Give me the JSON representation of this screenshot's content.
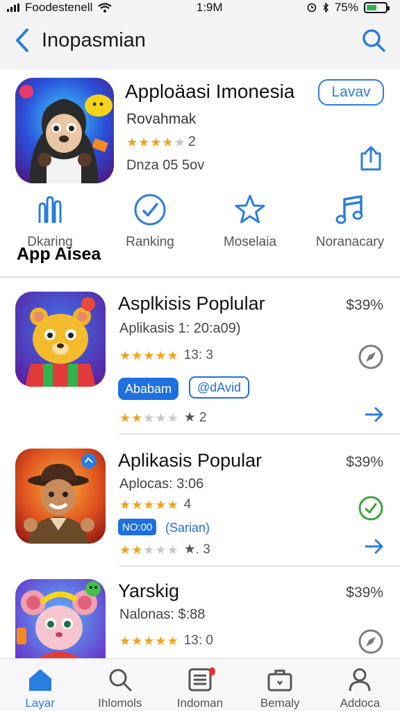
{
  "status_bar": {
    "carrier": "Foodestenell",
    "time": "1:9M",
    "battery_text": "75%",
    "battery_level": 0.55
  },
  "nav": {
    "back_icon": "chevron-left-icon",
    "title": "Inopasmian",
    "search_icon": "search-icon"
  },
  "featured": {
    "title": "Apploäasi Imonesia",
    "get_label": "Lavav",
    "developer": "Rovahmak",
    "rating_stars": 4,
    "rating_text": "2",
    "date": "Dnza 05 5ov",
    "share_icon": "share-icon"
  },
  "categories": [
    {
      "icon": "chart-bars-icon",
      "label": "Dkaring"
    },
    {
      "icon": "check-circle-icon",
      "label": "Ranking"
    },
    {
      "icon": "star-outline-icon",
      "label": "Moselaia"
    },
    {
      "icon": "music-note-icon",
      "label": "Noranacary"
    }
  ],
  "section_label": "App Aisea",
  "apps": [
    {
      "title": "Asplkisis Poplular",
      "price": "$39%",
      "subtitle": "Aplikasis 1: 20:a09)",
      "rating1_stars": 5,
      "rating1_text": "13:  3",
      "tags": [
        "Ababam",
        "@dAvid"
      ],
      "rating2_stars": 2,
      "rating2_text": "★  2",
      "action_icon": "compass-icon"
    },
    {
      "title": "Aplikasis Popular",
      "price": "$39%",
      "subtitle": "Aplocas: 3:06",
      "rating1_stars": 5,
      "rating1_text": "4",
      "tags": [
        "NO:00",
        "(Sarian)"
      ],
      "rating2_stars": 2,
      "rating2_text": "★. 3",
      "action_icon": "check-circle-icon"
    },
    {
      "title": "Yarskig",
      "price": "$39%",
      "subtitle": "Nalonas: $:88",
      "rating1_stars": 5,
      "rating1_text": "13:  0",
      "action_icon": "compass-icon"
    }
  ],
  "tabs": [
    {
      "icon": "home-icon",
      "label": "Layar"
    },
    {
      "icon": "search-icon",
      "label": "Ihlomols"
    },
    {
      "icon": "list-icon",
      "label": "Indoman"
    },
    {
      "icon": "briefcase-icon",
      "label": "Bemaly"
    },
    {
      "icon": "person-icon",
      "label": "Addoca"
    }
  ],
  "colors": {
    "accent": "#2a7de1",
    "star": "#f3a21b",
    "badge": "#e5312f",
    "battery": "#2fb34a"
  }
}
